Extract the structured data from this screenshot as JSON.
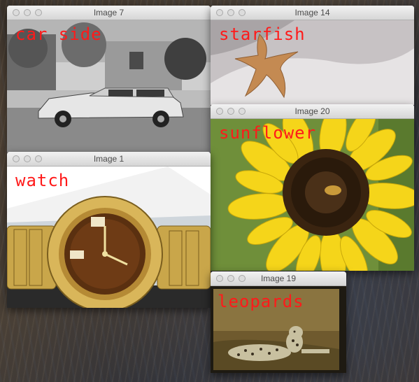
{
  "windows": {
    "car": {
      "title": "Image 7",
      "label": "car side"
    },
    "starfish": {
      "title": "Image 14",
      "label": "starfish"
    },
    "sunflower": {
      "title": "Image 20",
      "label": "sunflower"
    },
    "watch": {
      "title": "Image 1",
      "label": "watch"
    },
    "leopards": {
      "title": "Image 19",
      "label": "leopards"
    }
  },
  "colors": {
    "label": "#ff1a1a",
    "titlebar": "#e0e0e0"
  }
}
